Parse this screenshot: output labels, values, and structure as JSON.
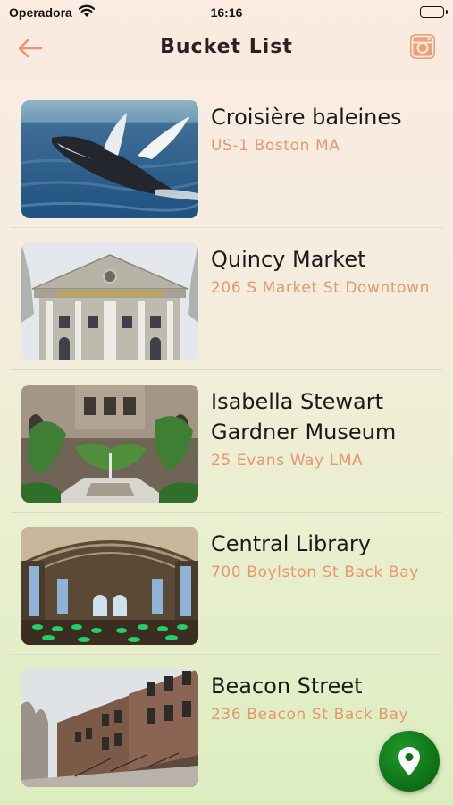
{
  "status_bar": {
    "carrier": "Operadora",
    "time": "16:16"
  },
  "header": {
    "title": "Bucket List",
    "back_icon": "arrow-left-icon",
    "right_icon": "instagram-icon",
    "accent_color": "#e8976a"
  },
  "items": [
    {
      "name": "Croisière baleines",
      "address": "US-1 Boston MA",
      "image": "whale-photo"
    },
    {
      "name": "Quincy Market",
      "address": "206 S Market St Downtown",
      "image": "quincy-market-photo"
    },
    {
      "name": "Isabella Stewart Gardner Museum",
      "address": "25 Evans Way LMA",
      "image": "gardner-courtyard-photo"
    },
    {
      "name": "Central Library",
      "address": "700 Boylston St Back Bay",
      "image": "library-reading-room-photo"
    },
    {
      "name": "Beacon Street",
      "address": "236 Beacon St Back Bay",
      "image": "beacon-street-photo"
    }
  ],
  "fab": {
    "icon": "map-pin-icon",
    "color": "#0d6e15"
  }
}
